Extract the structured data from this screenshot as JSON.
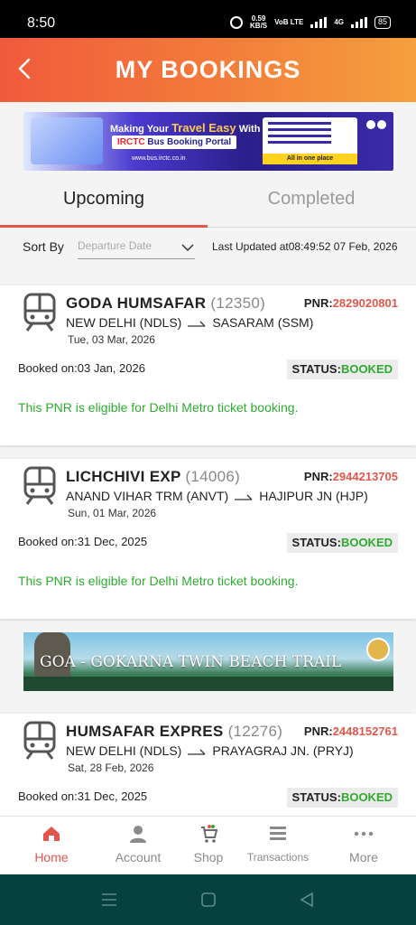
{
  "status_bar": {
    "time": "8:50",
    "speed_value": "0.59",
    "speed_unit": "KB/S",
    "network_label": "VoB LTE",
    "network_type": "4G",
    "battery": "85"
  },
  "header": {
    "title": "MY BOOKINGS",
    "back_icon": "chevron-left-icon",
    "gradient": [
      "#f15a3d",
      "#f5a03e"
    ]
  },
  "banner_top": {
    "line1_prefix": "Making Your",
    "line1_highlight": "Travel Easy",
    "line1_suffix": "With",
    "pill_prefix": "IRCTC",
    "pill_text": "Bus Booking Portal",
    "tagline": "All in one place",
    "url": "www.bus.irctc.co.in"
  },
  "tabs": [
    {
      "label": "Upcoming",
      "active": true
    },
    {
      "label": "Completed",
      "active": false
    }
  ],
  "sort": {
    "label": "Sort By",
    "placeholder": "Departure Date",
    "last_updated": "Last Updated at08:49:52 07 Feb, 2026"
  },
  "bookings": [
    {
      "train_name": "GODA HUMSAFAR",
      "train_number": "(12350)",
      "pnr_label": "PNR:",
      "pnr": "2829020801",
      "from": "NEW DELHI (NDLS)",
      "to": "SASARAM (SSM)",
      "date": "Tue, 03 Mar, 2026",
      "booked_on": "Booked on:03 Jan, 2026",
      "status_label": "STATUS:",
      "status": "BOOKED",
      "note": "This PNR is eligible for Delhi Metro ticket booking."
    },
    {
      "train_name": "LICHCHIVI EXP",
      "train_number": "(14006)",
      "pnr_label": "PNR:",
      "pnr": "2944213705",
      "from": "ANAND VIHAR TRM (ANVT)",
      "to": "HAJIPUR JN (HJP)",
      "date": "Sun, 01 Mar, 2026",
      "booked_on": "Booked on:31 Dec, 2025",
      "status_label": "STATUS:",
      "status": "BOOKED",
      "note": "This PNR is eligible for Delhi Metro ticket booking."
    },
    {
      "train_name": "HUMSAFAR EXPRES",
      "train_number": "(12276)",
      "pnr_label": "PNR:",
      "pnr": "2448152761",
      "from": "NEW DELHI (NDLS)",
      "to": "PRAYAGRAJ JN. (PRYJ)",
      "date": "Sat, 28 Feb, 2026",
      "booked_on": "Booked on:31 Dec, 2025",
      "status_label": "STATUS:",
      "status": "BOOKED"
    }
  ],
  "banner_mid": {
    "title": "GOA - GOKARNA TWIN BEACH TRAIL"
  },
  "bottom_nav": [
    {
      "label": "Home",
      "icon": "home-icon",
      "active": true
    },
    {
      "label": "Account",
      "icon": "user-icon",
      "active": false
    },
    {
      "label": "Shop",
      "icon": "shop-cart-icon",
      "active": false
    },
    {
      "label": "Transactions",
      "icon": "list-icon",
      "active": false
    },
    {
      "label": "More",
      "icon": "more-dots-icon",
      "active": false
    }
  ],
  "colors": {
    "accent": "#e2574c",
    "status_green": "#2eab2e",
    "system_nav": "#06403f"
  }
}
